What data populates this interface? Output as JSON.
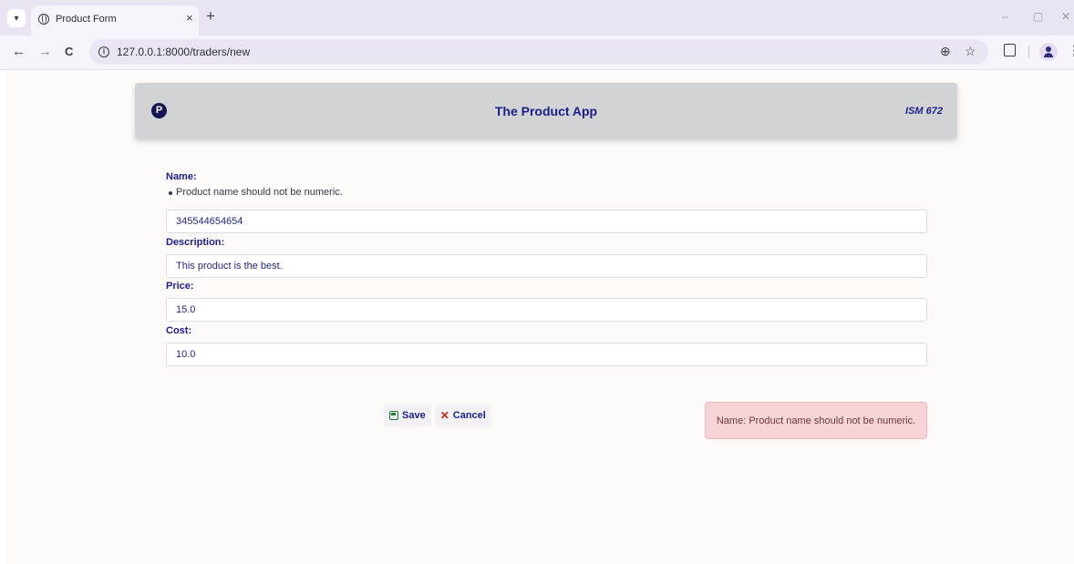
{
  "browser": {
    "tab_title": "Product Form",
    "tab_close": "×",
    "new_tab": "+",
    "url": "127.0.0.1:8000/traders/new",
    "controls": {
      "back": "←",
      "forward": "→",
      "reload": "C",
      "zoom": "⊕",
      "bookmark": "☆",
      "more": "⋮",
      "minimize": "–",
      "maximize": "▢",
      "close": "✕"
    },
    "tab_menu_glyph": "▾"
  },
  "header": {
    "logo_letter": "P",
    "title": "The Product App",
    "course": "ISM 672"
  },
  "form": {
    "name_label": "Name:",
    "name_error": "Product name should not be numeric.",
    "name_value": "345544654654",
    "description_label": "Description:",
    "description_value": "This product is the best.",
    "price_label": "Price:",
    "price_value": "15.0",
    "cost_label": "Cost:",
    "cost_value": "10.0"
  },
  "actions": {
    "save_label": "Save",
    "cancel_label": "Cancel",
    "cancel_glyph": "✕"
  },
  "alert": {
    "message": "Name: Product name should not be numeric."
  },
  "icons": {
    "favicon": "globe-icon",
    "logo": "product-logo-icon",
    "save": "save-icon",
    "cancel": "cancel-icon"
  },
  "colors": {
    "accent": "#1b1e8a",
    "header_bg": "#d2d3d4",
    "alert_bg": "#f6d4d6",
    "page_bg": "#fdf9f8"
  }
}
